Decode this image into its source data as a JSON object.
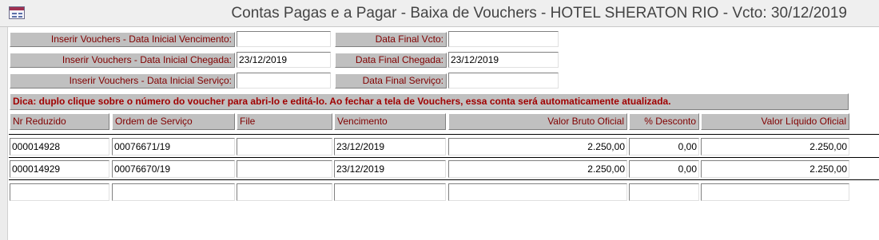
{
  "window": {
    "title": "Contas Pagas e a Pagar - Baixa de Vouchers - HOTEL SHERATON RIO - Vcto: 30/12/2019"
  },
  "filters": {
    "venc_inicial_label": "Inserir Vouchers - Data Inicial Vencimento:",
    "venc_inicial_value": "",
    "venc_final_label": "Data Final Vcto:",
    "venc_final_value": "",
    "chegada_inicial_label": "Inserir Vouchers - Data Inicial Chegada:",
    "chegada_inicial_value": "23/12/2019",
    "chegada_final_label": "Data Final Chegada:",
    "chegada_final_value": "23/12/2019",
    "servico_inicial_label": "Inserir Vouchers - Data Inicial Serviço:",
    "servico_inicial_value": "",
    "servico_final_label": "Data Final Serviço:",
    "servico_final_value": ""
  },
  "tip": "Dica: duplo clique sobre o número do voucher para abri-lo e editá-lo. Ao fechar a tela de Vouchers, essa conta será automaticamente atualizada.",
  "table": {
    "headers": {
      "nr_reduzido": "Nr Reduzido",
      "ordem_servico": "Ordem de Serviço",
      "file": "File",
      "vencimento": "Vencimento",
      "valor_bruto": "Valor Bruto Oficial",
      "desconto": "% Desconto",
      "valor_liquido": "Valor Líquido Oficial"
    },
    "rows": [
      {
        "nr_reduzido": "000014928",
        "ordem_servico": "00076671/19",
        "file": "",
        "vencimento": "23/12/2019",
        "valor_bruto": "2.250,00",
        "desconto": "0,00",
        "valor_liquido": "2.250,00"
      },
      {
        "nr_reduzido": "000014929",
        "ordem_servico": "00076670/19",
        "file": "",
        "vencimento": "23/12/2019",
        "valor_bruto": "2.250,00",
        "desconto": "0,00",
        "valor_liquido": "2.250,00"
      },
      {
        "nr_reduzido": "",
        "ordem_servico": "",
        "file": "",
        "vencimento": "",
        "valor_bruto": "",
        "desconto": "",
        "valor_liquido": ""
      }
    ]
  }
}
